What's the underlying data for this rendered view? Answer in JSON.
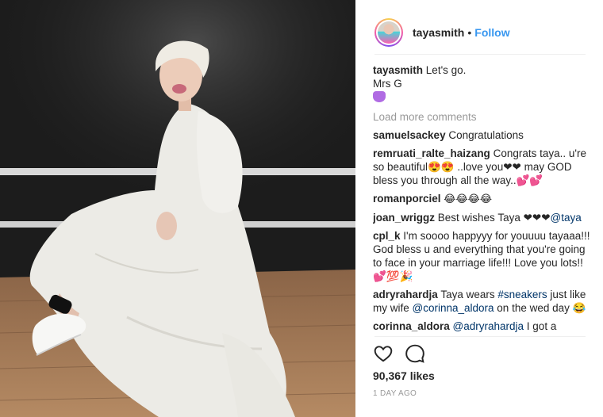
{
  "post": {
    "username": "tayasmith",
    "follow_label": "Follow",
    "separator": "•",
    "caption_lines": [
      "Let's go.",
      "Mrs G"
    ],
    "load_more": "Load more comments",
    "likes": "90,367 likes",
    "time": "1 DAY AGO"
  },
  "comments": [
    {
      "user": "samuelsackey",
      "text": "Congratulations"
    },
    {
      "user": "remruati_ralte_haizang",
      "text": "Congrats taya.. u're so beautiful😍😍 ..love you❤❤ may GOD bless you through all the way..💕💕"
    },
    {
      "user": "romanporciel",
      "text": "😂😂😂😂"
    },
    {
      "user": "joan_wriggz",
      "text_before": "Best wishes Taya ❤❤❤",
      "mention": "@taya"
    },
    {
      "user": "cpl_k",
      "text": "I'm soooo happyyy for youuuu tayaaa!!! God bless u and everything that you're going to face in your marriage life!!! Love you lots!! 💕💯🎉"
    },
    {
      "user": "adryrahardja",
      "text_before": "Taya wears ",
      "tag": "#sneakers",
      "text_middle": " just like my wife ",
      "mention": "@corinna_aldora",
      "text_after": " on the wed day 😂"
    },
    {
      "user": "corinna_aldora",
      "mention": "@adryrahardja",
      "text_after": " I got a"
    }
  ],
  "icons": [
    "heart-icon",
    "comment-icon"
  ],
  "colors": {
    "link": "#3897f0",
    "mention": "#003569",
    "muted": "#999999"
  }
}
